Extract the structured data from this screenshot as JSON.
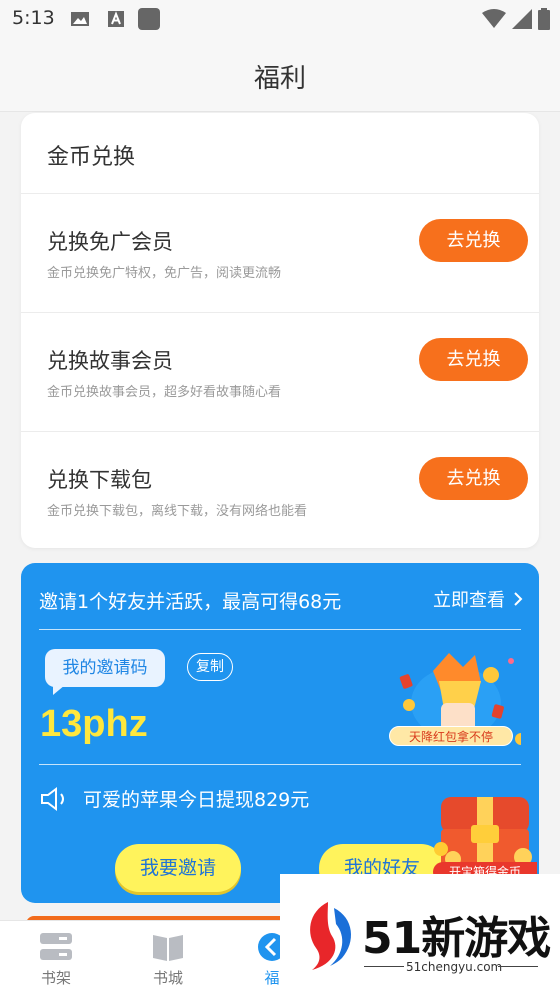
{
  "status_bar": {
    "time": "5:13"
  },
  "header": {
    "title": "福利"
  },
  "exchange": {
    "heading": "金币兑换",
    "items": [
      {
        "title": "兑换免广会员",
        "desc": "金币兑换免广特权，免广告，阅读更流畅",
        "button": "去兑换"
      },
      {
        "title": "兑换故事会员",
        "desc": "金币兑换故事会员，超多好看故事随心看",
        "button": "去兑换"
      },
      {
        "title": "兑换下载包",
        "desc": "金币兑换下载包，离线下载，没有网络也能看",
        "button": "去兑换"
      }
    ]
  },
  "invite": {
    "headline": "邀请1个好友并活跃，最高可得68元",
    "view_now": "立即查看",
    "code_label": "我的邀请码",
    "copy": "复制",
    "code": "13phz",
    "promo_tag": "天降红包拿不停",
    "ticker": "可爱的苹果今日提现829元",
    "invite_button": "我要邀请",
    "friends_button": "我的好友",
    "chest_label": "开宝箱得金币"
  },
  "bottom_nav": {
    "items": [
      {
        "label": "书架"
      },
      {
        "label": "书城"
      },
      {
        "label": "福"
      }
    ]
  },
  "watermark": {
    "brand": "51新游戏",
    "url": "51chengyu.com"
  },
  "colors": {
    "accent_orange": "#f7701c",
    "invite_blue": "#1f94ef",
    "highlight_yellow": "#ffe73d"
  }
}
